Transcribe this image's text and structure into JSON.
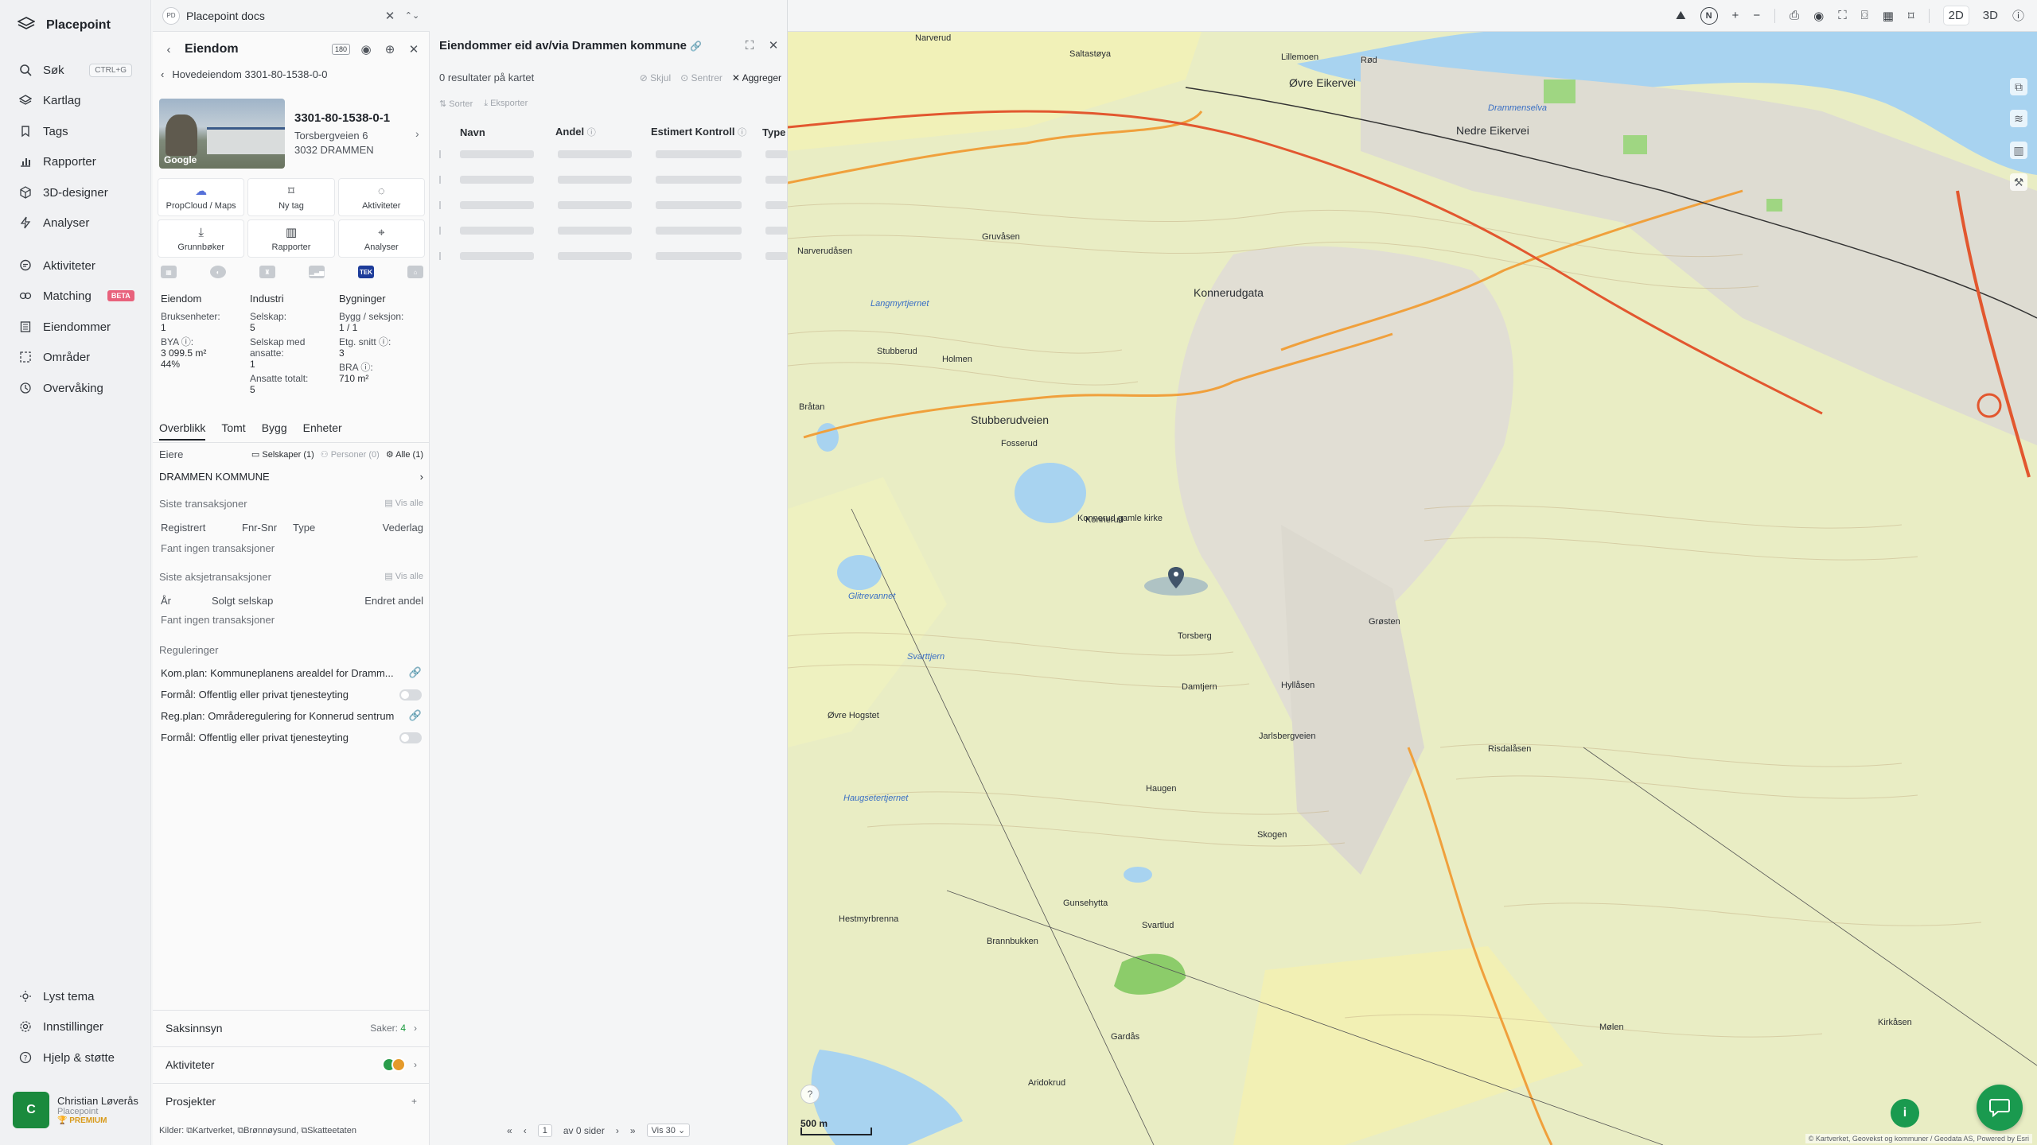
{
  "nav": {
    "brand": "Placepoint",
    "items": [
      {
        "label": "Søk",
        "shortcut": "CTRL+G",
        "icon": "search-icon"
      },
      {
        "label": "Kartlag",
        "icon": "layers-icon"
      },
      {
        "label": "Tags",
        "icon": "bookmark-icon"
      },
      {
        "label": "Rapporter",
        "icon": "bar-chart-icon"
      },
      {
        "label": "3D-designer",
        "icon": "cube-icon"
      },
      {
        "label": "Analyser",
        "icon": "bolt-icon"
      },
      {
        "label": "Aktiviteter",
        "icon": "chat-icon"
      },
      {
        "label": "Matching",
        "badge": "BETA",
        "icon": "match-icon"
      },
      {
        "label": "Eiendommer",
        "icon": "building-icon"
      },
      {
        "label": "Områder",
        "icon": "area-icon"
      },
      {
        "label": "Overvåking",
        "icon": "monitor-icon"
      }
    ],
    "bottom": [
      {
        "label": "Lyst tema",
        "icon": "sun-icon"
      },
      {
        "label": "Innstillinger",
        "icon": "gear-icon"
      },
      {
        "label": "Hjelp & støtte",
        "icon": "help-icon"
      }
    ],
    "user": {
      "initial": "C",
      "name": "Christian Løverås",
      "org": "Placepoint",
      "plan": "PREMIUM"
    }
  },
  "doc_bar": {
    "badge": "PD",
    "title": "Placepoint docs"
  },
  "property": {
    "title": "Eiendom",
    "tag_button": "180",
    "breadcrumb": "Hovedeiendom 3301-80-1538-0-0",
    "photo_brand": "Google",
    "id": "3301-80-1538-0-1",
    "street": "Torsbergveien 6",
    "postal": "3032 DRAMMEN",
    "actions": [
      {
        "label": "PropCloud / Maps",
        "icon": "cloud-icon"
      },
      {
        "label": "Ny tag",
        "icon": "bookmark-icon"
      },
      {
        "label": "Aktiviteter",
        "icon": "chat-icon"
      },
      {
        "label": "Grunnbøker",
        "icon": "download-icon"
      },
      {
        "label": "Rapporter",
        "icon": "bar-chart-icon"
      },
      {
        "label": "Analyser",
        "icon": "pin-icon"
      }
    ],
    "source_tek": "TEK",
    "facts": {
      "col1": {
        "head": "Eiendom",
        "l1": "Bruksenheter:",
        "v1": "1",
        "l2": "BYA ⓘ:",
        "v2": "3 099.5 m²",
        "v3": "44%"
      },
      "col2": {
        "head": "Industri",
        "l1": "Selskap:",
        "v1": "5",
        "l2": "Selskap med ansatte:",
        "v2": "1",
        "l3": "Ansatte totalt:",
        "v3": "5"
      },
      "col3": {
        "head": "Bygninger",
        "l1": "Bygg / seksjon:",
        "v1": "1 / 1",
        "l2": "Etg. snitt ⓘ:",
        "v2": "3",
        "l3": "BRA ⓘ:",
        "v3": "710 m²"
      }
    },
    "tabs": [
      "Overblikk",
      "Tomt",
      "Bygg",
      "Enheter"
    ],
    "owners": {
      "label": "Eiere",
      "chip_companies": "Selskaper (1)",
      "chip_persons": "Personer (0)",
      "chip_all": "Alle (1)",
      "owner_name": "DRAMMEN KOMMUNE"
    },
    "transactions": {
      "title": "Siste transaksjoner",
      "see_all": "Vis alle",
      "cols": [
        "Registrert",
        "Fnr-Snr",
        "Type",
        "Vederlag"
      ],
      "empty": "Fant ingen transaksjoner"
    },
    "share_transactions": {
      "title": "Siste aksjetransaksjoner",
      "see_all": "Vis alle",
      "cols": [
        "År",
        "Solgt selskap",
        "Endret andel"
      ],
      "empty": "Fant ingen transaksjoner"
    },
    "regulations": {
      "title": "Reguleringer",
      "rows": [
        {
          "text": "Kom.plan: Kommuneplanens arealdel for Dramm...",
          "kind": "link"
        },
        {
          "text": "Formål: Offentlig eller privat tjenesteyting",
          "kind": "toggle"
        },
        {
          "text": "Reg.plan: Områderegulering for Konnerud sentrum",
          "kind": "link"
        },
        {
          "text": "Formål: Offentlig eller privat tjenesteyting",
          "kind": "toggle"
        }
      ]
    },
    "saksinnsyn": {
      "label": "Saksinnsyn",
      "count_label": "Saker:",
      "count": "4"
    },
    "aktiviteter": {
      "label": "Aktiviteter"
    },
    "prosjekter": {
      "label": "Prosjekter",
      "add": "+"
    },
    "sources": "Kilder: ⧉Kartverket, ⧉Brønnøysund, ⧉Skatteetaten"
  },
  "results": {
    "title": "Eiendommer eid av/via Drammen kommune",
    "count": "0 resultater på kartet",
    "hide": "Skjul",
    "center": "Sentrer",
    "aggregate": "Aggreger",
    "sort": "Sorter",
    "export": "Eksporter",
    "columns": [
      "Navn",
      "Andel",
      "Estimert Kontroll",
      "Type"
    ],
    "pager": {
      "page": "1",
      "of_pages": "av 0 sider",
      "per_page": "Vis 30"
    }
  },
  "map": {
    "mode_2d": "2D",
    "mode_3d": "3D",
    "north": "N",
    "scale": "500 m",
    "attribution": "© Kartverket, Geovekst og kommuner / Geodata AS, Powered by Esri",
    "labels": [
      {
        "text": "Narverud"
      },
      {
        "text": "Saltastøya"
      },
      {
        "text": "Lillemoen"
      },
      {
        "text": "Rød"
      },
      {
        "text": "Øvre Eikervei"
      },
      {
        "text": "Nedre Eikervei"
      },
      {
        "text": "Drammenselva"
      },
      {
        "text": "Konnerudgata"
      },
      {
        "text": "Stubberudveien"
      },
      {
        "text": "Konnerud"
      },
      {
        "text": "Torsberg"
      },
      {
        "text": "Damtjern"
      },
      {
        "text": "Svarttjern"
      },
      {
        "text": "Haugen"
      },
      {
        "text": "Svartlud"
      },
      {
        "text": "Gardås"
      },
      {
        "text": "Aridokrud"
      },
      {
        "text": "Skogen"
      },
      {
        "text": "Kirkåsen"
      },
      {
        "text": "Mølen"
      },
      {
        "text": "Grøsten"
      },
      {
        "text": "Risdalåsen"
      },
      {
        "text": "Fosserud"
      },
      {
        "text": "Gruvåsen"
      },
      {
        "text": "Holmen"
      },
      {
        "text": "Bråtan"
      },
      {
        "text": "Hyllåsen"
      },
      {
        "text": "Jarlsbergveien"
      },
      {
        "text": "Stubberud"
      },
      {
        "text": "Konnerud gamle kirke"
      },
      {
        "text": "Langmyrtjernet"
      },
      {
        "text": "Haugsetertjernet"
      },
      {
        "text": "Gunsehytta"
      },
      {
        "text": "Brannbukken"
      },
      {
        "text": "Hestmyrbrenna"
      },
      {
        "text": "Glitrevannet"
      },
      {
        "text": "Øvre Hogstet"
      },
      {
        "text": "Narverudåsen"
      }
    ]
  }
}
